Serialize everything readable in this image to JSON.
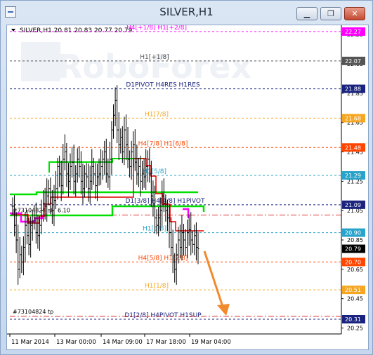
{
  "window": {
    "title": "SILVER,H1",
    "minimize_glyph": "▁",
    "restore_glyph": "❐",
    "close_glyph": "✕"
  },
  "chart": {
    "info": "SILVER,H1  20.81 20.83 20.77 20.79",
    "watermark": "RoboForex",
    "order_label_top": "#73104824 sl",
    "order_label_top_suffix": "6.10",
    "order_label_bottom": "#73104824 tp",
    "current_price": "20.79"
  },
  "chart_data": {
    "type": "candlestick",
    "symbol": "SILVER",
    "timeframe": "H1",
    "ohlc_last": {
      "open": 20.81,
      "high": 20.83,
      "low": 20.77,
      "close": 20.79
    },
    "y_ticks": [
      "22.27",
      "22.07",
      "21.88",
      "21.68",
      "21.48",
      "21.29",
      "21.09",
      "20.90",
      "20.70",
      "20.51",
      "20.31",
      "21.25",
      "21.05",
      "20.85",
      "20.65",
      "20.45",
      "20.25",
      "21.45",
      "21.65",
      "21.85",
      "22.05",
      "22.25"
    ],
    "x_ticks": [
      "11 Mar 2014",
      "13 Mar 00:00",
      "14 Mar 09:00",
      "17 Mar 18:00",
      "19 Mar 04:00"
    ],
    "levels": [
      {
        "label": "H4[+1/8] H1[+2/8]",
        "price": 22.27,
        "color": "#ff00ff"
      },
      {
        "label": "H1[+1/8]",
        "price": 22.07,
        "color": "#555555"
      },
      {
        "label": "D1PIVOT H4RES H1RES",
        "price": 21.88,
        "color": "#1a237e"
      },
      {
        "label": "H1[7/8]",
        "price": 21.68,
        "color": "#f5a623"
      },
      {
        "label": "H4[7/8] H1[6/8]",
        "price": 21.48,
        "color": "#ff4500"
      },
      {
        "label": "H1[5/8]",
        "price": 21.29,
        "color": "#29a3c9"
      },
      {
        "label": "D1[3/8] H4[4/8] H1PIVOT",
        "price": 21.09,
        "color": "#1a237e"
      },
      {
        "label": "H1[3/8]",
        "price": 20.9,
        "color": "#29a3c9"
      },
      {
        "label": "H4[5/8] H1[2/8]",
        "price": 20.7,
        "color": "#ff4500"
      },
      {
        "label": "H1[1/8]",
        "price": 20.51,
        "color": "#f5a623"
      },
      {
        "label": "D1[2/8] H4PIVOT H1SUP",
        "price": 20.31,
        "color": "#1a237e"
      }
    ],
    "price_badges": [
      {
        "text": "22.27",
        "bg": "#ff00ff"
      },
      {
        "text": "22.07",
        "bg": "#555555"
      },
      {
        "text": "21.88",
        "bg": "#1a237e"
      },
      {
        "text": "21.68",
        "bg": "#f5a623"
      },
      {
        "text": "21.48",
        "bg": "#ff4500"
      },
      {
        "text": "21.29",
        "bg": "#29a3c9"
      },
      {
        "text": "21.09",
        "bg": "#1a237e"
      },
      {
        "text": "20.90",
        "bg": "#29a3c9"
      },
      {
        "text": "20.79",
        "bg": "#000000"
      },
      {
        "text": "20.70",
        "bg": "#ff4500"
      },
      {
        "text": "20.51",
        "bg": "#f5a623"
      },
      {
        "text": "20.31",
        "bg": "#1a237e"
      }
    ],
    "axis_ticks": [
      "21.25",
      "21.05",
      "20.85",
      "20.65",
      "20.45",
      "20.25",
      "21.45",
      "21.65",
      "21.85",
      "22.05",
      "22.25"
    ],
    "order_sl_price": 21.02,
    "order_tp_price": 20.33
  }
}
